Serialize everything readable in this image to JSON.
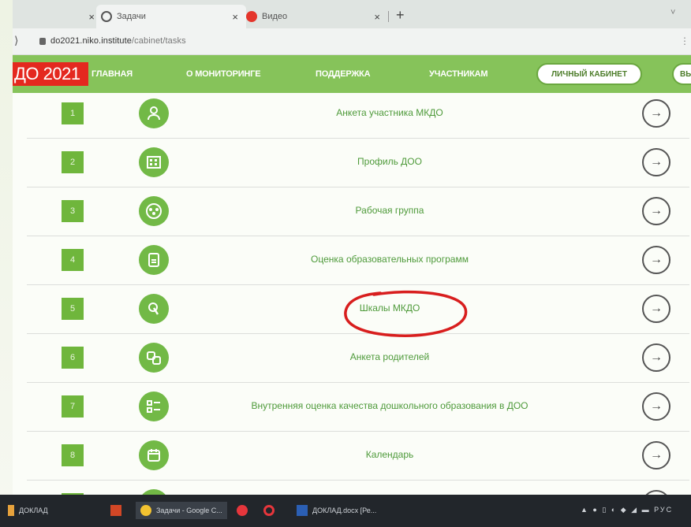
{
  "browser": {
    "tabs": [
      {
        "label": "",
        "close": "×"
      },
      {
        "label": "Задачи",
        "close": "×"
      },
      {
        "label": "Видео",
        "close": "×"
      }
    ],
    "new_tab": "+",
    "window_controls": "˅",
    "url_domain": "do2021.niko.institute",
    "url_path": "/cabinet/tasks",
    "menu": "⋮"
  },
  "site": {
    "logo": "ДО 2021",
    "nav": [
      "ГЛАВНАЯ",
      "О МОНИТОРИНГЕ",
      "ПОДДЕРЖКА",
      "УЧАСТНИКАМ"
    ],
    "cabinet_button": "ЛИЧНЫЙ КАБИНЕТ",
    "exit_button": "ВЫ"
  },
  "tasks": [
    {
      "num": "1",
      "title": "Анкета участника МКДО",
      "icon": "person-icon"
    },
    {
      "num": "2",
      "title": "Профиль ДОО",
      "icon": "building-icon"
    },
    {
      "num": "3",
      "title": "Рабочая группа",
      "icon": "group-icon"
    },
    {
      "num": "4",
      "title": "Оценка образовательных программ",
      "icon": "document-icon"
    },
    {
      "num": "5",
      "title": "Шкалы МКДО",
      "icon": "pointer-icon"
    },
    {
      "num": "6",
      "title": "Анкета родителей",
      "icon": "family-icon"
    },
    {
      "num": "7",
      "title": "Внутренняя оценка качества дошкольного образования в ДОО",
      "icon": "checklist-icon"
    },
    {
      "num": "8",
      "title": "Календарь",
      "icon": "calendar-icon"
    }
  ],
  "arrow_glyph": "→",
  "colors": {
    "nav_green": "#86c35a",
    "logo_red": "#e4281f",
    "task_green": "#6fb63c",
    "highlight_red": "#d81e1e"
  },
  "taskbar": {
    "items": [
      "ДОКЛАД",
      "Задачи - Google C...",
      "ДОКЛАД.docx [Ре..."
    ],
    "tray": "РУС"
  }
}
